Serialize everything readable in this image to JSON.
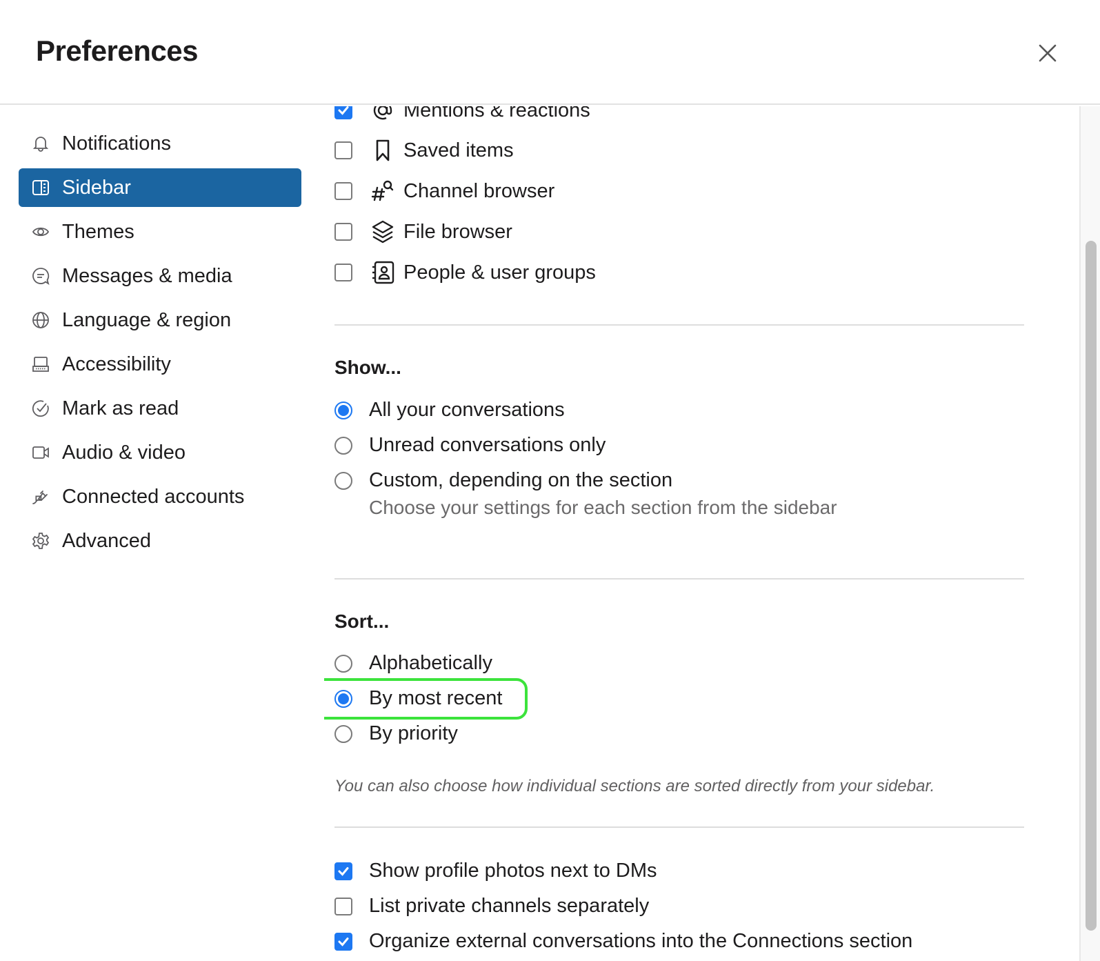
{
  "dialog": {
    "title": "Preferences",
    "close_label": "Close",
    "close_icon": "close-icon"
  },
  "nav": {
    "items": [
      {
        "label": "Notifications",
        "icon": "bell-icon",
        "active": false
      },
      {
        "label": "Sidebar",
        "icon": "sidebar-icon",
        "active": true
      },
      {
        "label": "Themes",
        "icon": "eye-icon",
        "active": false
      },
      {
        "label": "Messages & media",
        "icon": "message-icon",
        "active": false
      },
      {
        "label": "Language & region",
        "icon": "globe-icon",
        "active": false
      },
      {
        "label": "Accessibility",
        "icon": "laptop-icon",
        "active": false
      },
      {
        "label": "Mark as read",
        "icon": "check-circle-icon",
        "active": false
      },
      {
        "label": "Audio & video",
        "icon": "video-camera-icon",
        "active": false
      },
      {
        "label": "Connected accounts",
        "icon": "plug-icon",
        "active": false
      },
      {
        "label": "Advanced",
        "icon": "gear-icon",
        "active": false
      }
    ]
  },
  "always_show": {
    "items": [
      {
        "label": "Mentions & reactions",
        "icon": "at-sign-icon",
        "checked": true
      },
      {
        "label": "Saved items",
        "icon": "bookmark-icon",
        "checked": false
      },
      {
        "label": "Channel browser",
        "icon": "channel-search-icon",
        "checked": false
      },
      {
        "label": "File browser",
        "icon": "layers-icon",
        "checked": false
      },
      {
        "label": "People & user groups",
        "icon": "contact-book-icon",
        "checked": false
      }
    ]
  },
  "show": {
    "heading": "Show...",
    "options": [
      {
        "label": "All your conversations",
        "checked": true
      },
      {
        "label": "Unread conversations only",
        "checked": false
      },
      {
        "label": "Custom, depending on the section",
        "checked": false
      }
    ],
    "custom_hint": "Choose your settings for each section from the sidebar"
  },
  "sort": {
    "heading": "Sort...",
    "options": [
      {
        "label": "Alphabetically",
        "checked": false
      },
      {
        "label": "By most recent",
        "checked": true
      },
      {
        "label": "By priority",
        "checked": false
      }
    ],
    "note": "You can also choose how individual sections are sorted directly from your sidebar.",
    "highlight_color": "#3ce33c"
  },
  "other": {
    "items": [
      {
        "label": "Show profile photos next to DMs",
        "checked": true
      },
      {
        "label": "List private channels separately",
        "checked": false
      },
      {
        "label": "Organize external conversations into the Connections section",
        "checked": true
      }
    ]
  },
  "colors": {
    "accent": "#1d78f2",
    "nav_active": "#1b65a1"
  }
}
